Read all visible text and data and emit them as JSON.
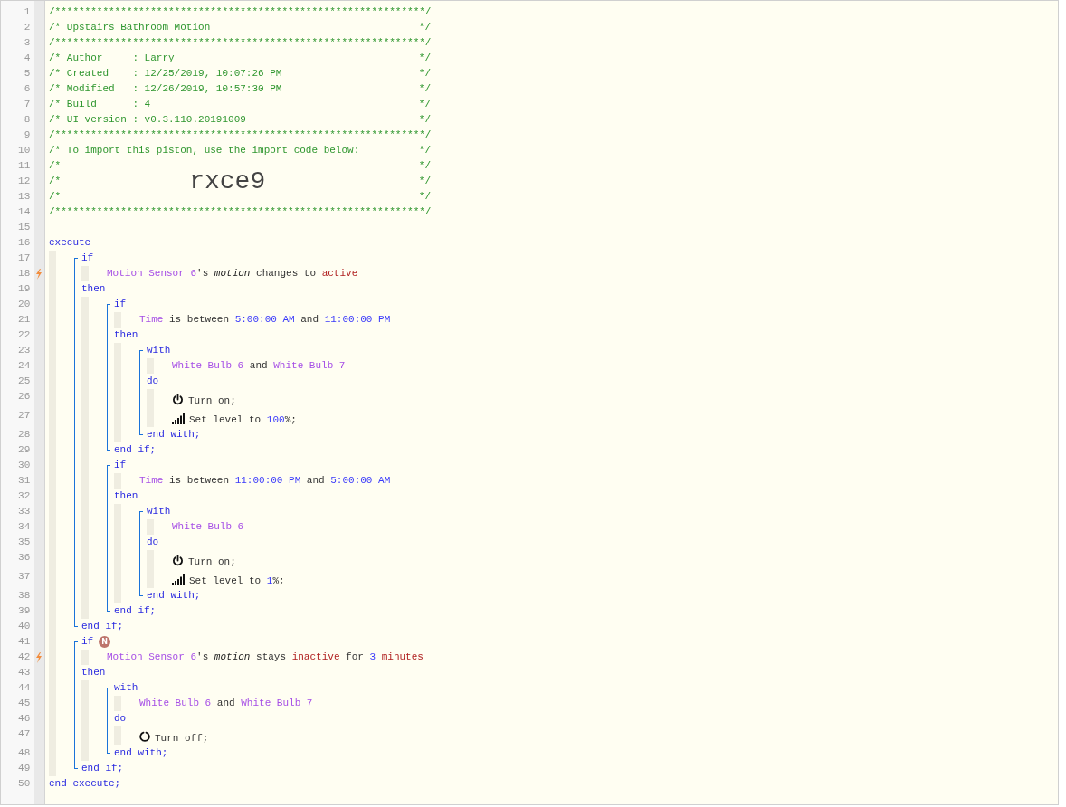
{
  "header": [
    {
      "number": "1",
      "text": "/**************************************************************/"
    },
    {
      "number": "2",
      "text": "/* Upstairs Bathroom Motion",
      "end": "*/"
    },
    {
      "number": "3",
      "text": "/**************************************************************/"
    },
    {
      "number": "4",
      "text": "/* Author     : Larry",
      "end": "*/"
    },
    {
      "number": "5",
      "text": "/* Created    : 12/25/2019, 10:07:26 PM",
      "end": "*/"
    },
    {
      "number": "6",
      "text": "/* Modified   : 12/26/2019, 10:57:30 PM",
      "end": "*/"
    },
    {
      "number": "7",
      "text": "/* Build      : 4",
      "end": "*/"
    },
    {
      "number": "8",
      "text": "/* UI version : v0.3.110.20191009",
      "end": "*/"
    },
    {
      "number": "9",
      "text": "/**************************************************************/"
    },
    {
      "number": "10",
      "text": "/* To import this piston, use the import code below:",
      "end": "*/"
    },
    {
      "number": "11",
      "text": "/*",
      "end": "*/"
    },
    {
      "number": "12",
      "text": "/*",
      "code": "rxce9",
      "end": "*/"
    },
    {
      "number": "13",
      "text": "/*",
      "end": "*/"
    },
    {
      "number": "14",
      "text": "/**************************************************************/"
    }
  ],
  "blank_line": {
    "number": "15"
  },
  "program": {
    "kind": "execute",
    "number": "16",
    "keyword": "execute",
    "children": [
      {
        "kind": "if",
        "number": "17",
        "keyword": "if",
        "conditions": [
          {
            "number": "18",
            "trigger": true,
            "tokens": [
              {
                "kind": "operand",
                "text": "Motion Sensor 6"
              },
              {
                "kind": "text",
                "text": "'s "
              },
              {
                "kind": "attribute",
                "text": "motion"
              },
              {
                "kind": "text",
                "text": " changes to "
              },
              {
                "kind": "value",
                "text": "active"
              }
            ]
          }
        ],
        "then": {
          "number": "19",
          "keyword": "then"
        },
        "children": [
          {
            "kind": "if",
            "number": "20",
            "keyword": "if",
            "conditions": [
              {
                "number": "21",
                "tokens": [
                  {
                    "kind": "operand",
                    "text": "Time"
                  },
                  {
                    "kind": "text",
                    "text": " is between "
                  },
                  {
                    "kind": "number",
                    "text": "5:00:00 AM"
                  },
                  {
                    "kind": "text",
                    "text": " and "
                  },
                  {
                    "kind": "number",
                    "text": "11:00:00 PM"
                  }
                ]
              }
            ],
            "then": {
              "number": "22",
              "keyword": "then"
            },
            "children": [
              {
                "kind": "with",
                "number": "23",
                "keyword": "with",
                "devices": [
                  {
                    "number": "24",
                    "tokens": [
                      {
                        "kind": "operand",
                        "text": "White Bulb 6"
                      },
                      {
                        "kind": "text",
                        "text": " and "
                      },
                      {
                        "kind": "operand",
                        "text": "White Bulb 7"
                      }
                    ]
                  }
                ],
                "do": {
                  "number": "25",
                  "keyword": "do"
                },
                "commands": [
                  {
                    "number": "26",
                    "kind": "switch-on",
                    "tokens": [
                      {
                        "kind": "text",
                        "text": "Turn on;"
                      }
                    ]
                  },
                  {
                    "number": "27",
                    "kind": "set-level",
                    "tokens": [
                      {
                        "kind": "text",
                        "text": "Set level to "
                      },
                      {
                        "kind": "number",
                        "text": "100"
                      },
                      {
                        "kind": "text",
                        "text": "%;"
                      }
                    ]
                  }
                ],
                "end": {
                  "number": "28",
                  "text": "end with;"
                }
              }
            ],
            "end": {
              "number": "29",
              "text": "end if;"
            }
          },
          {
            "kind": "if",
            "number": "30",
            "keyword": "if",
            "conditions": [
              {
                "number": "31",
                "tokens": [
                  {
                    "kind": "operand",
                    "text": "Time"
                  },
                  {
                    "kind": "text",
                    "text": " is between "
                  },
                  {
                    "kind": "number",
                    "text": "11:00:00 PM"
                  },
                  {
                    "kind": "text",
                    "text": " and "
                  },
                  {
                    "kind": "number",
                    "text": "5:00:00 AM"
                  }
                ]
              }
            ],
            "then": {
              "number": "32",
              "keyword": "then"
            },
            "children": [
              {
                "kind": "with",
                "number": "33",
                "keyword": "with",
                "devices": [
                  {
                    "number": "34",
                    "tokens": [
                      {
                        "kind": "operand",
                        "text": "White Bulb 6"
                      }
                    ]
                  }
                ],
                "do": {
                  "number": "35",
                  "keyword": "do"
                },
                "commands": [
                  {
                    "number": "36",
                    "kind": "switch-on",
                    "tokens": [
                      {
                        "kind": "text",
                        "text": "Turn on;"
                      }
                    ]
                  },
                  {
                    "number": "37",
                    "kind": "set-level",
                    "tokens": [
                      {
                        "kind": "text",
                        "text": "Set level to "
                      },
                      {
                        "kind": "number",
                        "text": "1"
                      },
                      {
                        "kind": "text",
                        "text": "%;"
                      }
                    ]
                  }
                ],
                "end": {
                  "number": "38",
                  "text": "end with;"
                }
              }
            ],
            "end": {
              "number": "39",
              "text": "end if;"
            }
          }
        ],
        "end": {
          "number": "40",
          "text": "end if;"
        }
      },
      {
        "kind": "if",
        "number": "41",
        "keyword": "if",
        "badge": "N",
        "conditions": [
          {
            "number": "42",
            "trigger": true,
            "tokens": [
              {
                "kind": "operand",
                "text": "Motion Sensor 6"
              },
              {
                "kind": "text",
                "text": "'s "
              },
              {
                "kind": "attribute",
                "text": "motion"
              },
              {
                "kind": "text",
                "text": " stays "
              },
              {
                "kind": "value",
                "text": "inactive"
              },
              {
                "kind": "text",
                "text": " for "
              },
              {
                "kind": "number",
                "text": "3"
              },
              {
                "kind": "value",
                "text": " minutes"
              }
            ]
          }
        ],
        "then": {
          "number": "43",
          "keyword": "then"
        },
        "children": [
          {
            "kind": "with",
            "number": "44",
            "keyword": "with",
            "devices": [
              {
                "number": "45",
                "tokens": [
                  {
                    "kind": "operand",
                    "text": "White Bulb 6"
                  },
                  {
                    "kind": "text",
                    "text": " and "
                  },
                  {
                    "kind": "operand",
                    "text": "White Bulb 7"
                  }
                ]
              }
            ],
            "do": {
              "number": "46",
              "keyword": "do"
            },
            "commands": [
              {
                "number": "47",
                "kind": "switch-off",
                "tokens": [
                  {
                    "kind": "text",
                    "text": "Turn off;"
                  }
                ]
              }
            ],
            "end": {
              "number": "48",
              "text": "end with;"
            }
          }
        ],
        "end": {
          "number": "49",
          "text": "end if;"
        }
      }
    ],
    "end": {
      "number": "50",
      "text": "end execute;"
    }
  }
}
